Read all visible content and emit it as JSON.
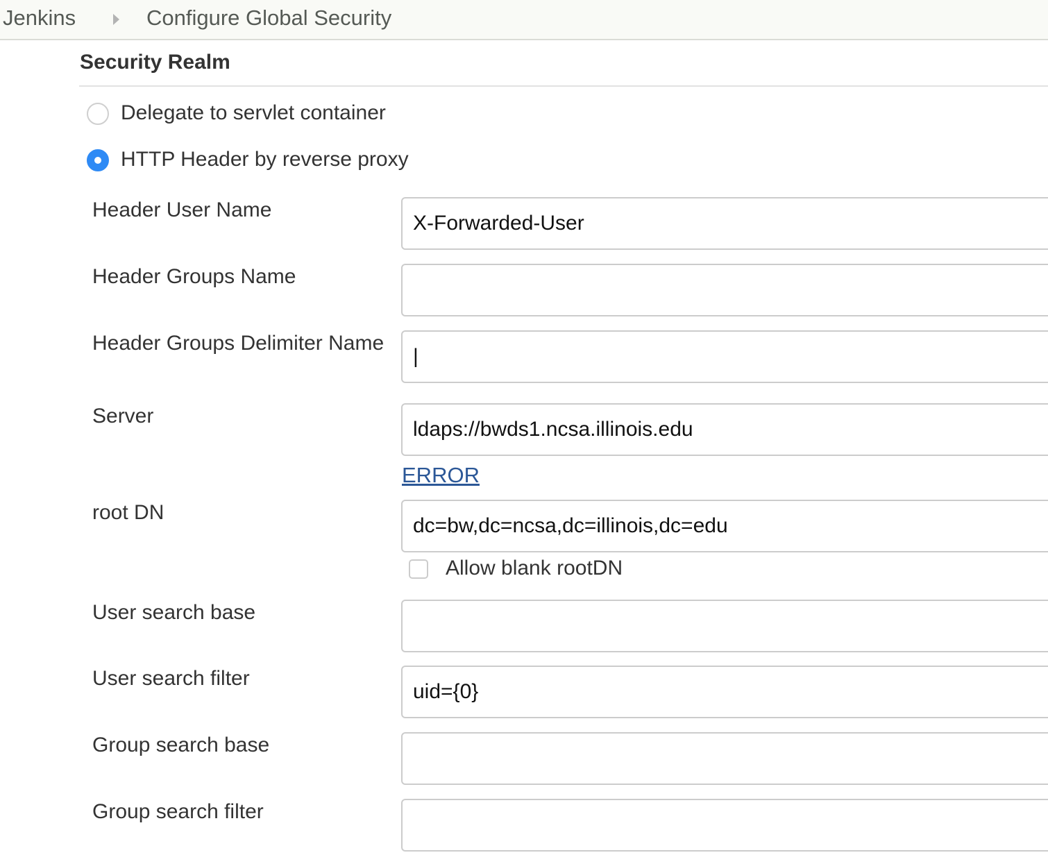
{
  "breadcrumb": {
    "root": "Jenkins",
    "current": "Configure Global Security"
  },
  "section": {
    "title": "Security Realm"
  },
  "realm_options": [
    {
      "label": "Delegate to servlet container",
      "selected": false
    },
    {
      "label": "HTTP Header by reverse proxy",
      "selected": true
    }
  ],
  "fields": {
    "header_user_name": {
      "label": "Header User Name",
      "value": "X-Forwarded-User"
    },
    "header_groups_name": {
      "label": "Header Groups Name",
      "value": ""
    },
    "header_groups_delimiter": {
      "label": "Header Groups Delimiter Name",
      "value": "|"
    },
    "server": {
      "label": "Server",
      "value": "ldaps://bwds1.ncsa.illinois.edu",
      "error_link": "ERROR"
    },
    "root_dn": {
      "label": "root DN",
      "value": "dc=bw,dc=ncsa,dc=illinois,dc=edu",
      "allow_blank_label": "Allow blank rootDN",
      "allow_blank_checked": false
    },
    "user_search_base": {
      "label": "User search base",
      "value": ""
    },
    "user_search_filter": {
      "label": "User search filter",
      "value": "uid={0}"
    },
    "group_search_base": {
      "label": "Group search base",
      "value": ""
    },
    "group_search_filter": {
      "label": "Group search filter",
      "value": ""
    }
  },
  "colors": {
    "radio_selected": "#2e8af5",
    "link": "#2b5797",
    "breadcrumb_bg": "#f9faf6"
  },
  "icons": {
    "breadcrumb_separator": "triangle-right-icon"
  }
}
